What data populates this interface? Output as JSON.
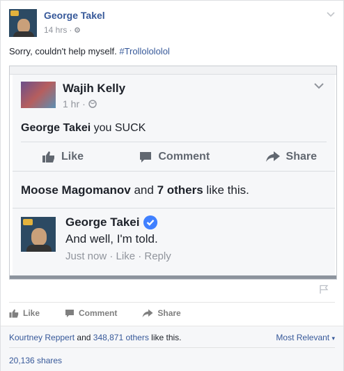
{
  "post": {
    "author": "George Takel",
    "time": "14 hrs",
    "text": "Sorry, couldn't help myself. ",
    "hashtag": "#Trollolololol"
  },
  "embedded": {
    "author": "Wajih Kelly",
    "time": "1 hr",
    "mention": "George Takei",
    "text": " you SUCK",
    "actions": {
      "like": "Like",
      "comment": "Comment",
      "share": "Share"
    },
    "likes": {
      "name": "Moose Magomanov",
      "and": " and ",
      "others": "7 others",
      "suffix": " like this."
    },
    "comment": {
      "author": "George Takei",
      "text": "And well, I'm told.",
      "meta": "Just now · Like · Reply"
    }
  },
  "actions": {
    "like": "Like",
    "comment": "Comment",
    "share": "Share"
  },
  "ufi": {
    "liker": "Kourtney Reppert",
    "and": " and ",
    "others": "348,871 others",
    "suffix": " like this.",
    "sort": "Most Relevant",
    "shares": "20,136 shares"
  },
  "colors": {
    "link": "#365899",
    "muted": "#90949c",
    "verified": "#4080ff"
  }
}
